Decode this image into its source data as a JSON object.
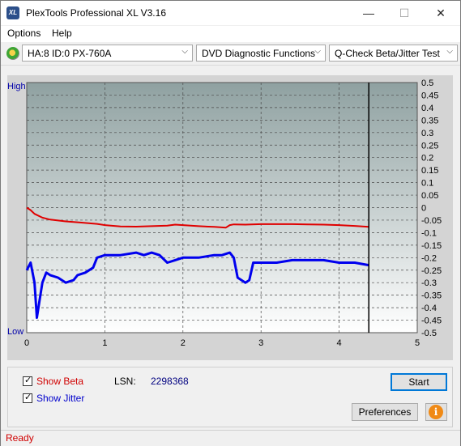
{
  "window": {
    "title": "PlexTools Professional XL V3.16",
    "app_icon_text": "XL",
    "minimize_glyph": "—",
    "maximize_glyph": "☐",
    "close_glyph": "✕"
  },
  "menu": {
    "options": "Options",
    "help": "Help"
  },
  "toolbar": {
    "drive": "HA:8 ID:0  PX-760A",
    "function": "DVD Diagnostic Functions",
    "test": "Q-Check Beta/Jitter Test"
  },
  "chart_data": {
    "type": "line",
    "x_ticks": [
      "0",
      "1",
      "2",
      "3",
      "4",
      "5"
    ],
    "xlim": [
      0,
      5
    ],
    "left_axis_labels": {
      "high": "High",
      "low": "Low"
    },
    "y_ticks": [
      "0.5",
      "0.45",
      "0.4",
      "0.35",
      "0.3",
      "0.25",
      "0.2",
      "0.15",
      "0.1",
      "0.05",
      "0",
      "-0.05",
      "-0.1",
      "-0.15",
      "-0.2",
      "-0.25",
      "-0.3",
      "-0.35",
      "-0.4",
      "-0.45",
      "-0.5"
    ],
    "ylim": [
      -0.5,
      0.5
    ],
    "grid": true,
    "end_marker_x": 4.38,
    "colors": {
      "beta": "#e00000",
      "jitter": "#0000ee",
      "top_bg": "#8fa1a1",
      "bottom_bg": "#ffffff"
    },
    "series": [
      {
        "name": "Beta",
        "color": "#e00000",
        "x": [
          0.0,
          0.05,
          0.1,
          0.2,
          0.3,
          0.5,
          0.7,
          0.9,
          1.0,
          1.2,
          1.4,
          1.6,
          1.8,
          1.9,
          2.0,
          2.2,
          2.4,
          2.55,
          2.6,
          2.65,
          2.8,
          3.0,
          3.2,
          3.4,
          3.6,
          3.8,
          4.0,
          4.2,
          4.38
        ],
        "y": [
          0.0,
          -0.01,
          -0.025,
          -0.04,
          -0.048,
          -0.055,
          -0.06,
          -0.065,
          -0.07,
          -0.075,
          -0.076,
          -0.074,
          -0.072,
          -0.068,
          -0.07,
          -0.074,
          -0.077,
          -0.08,
          -0.07,
          -0.067,
          -0.068,
          -0.066,
          -0.066,
          -0.066,
          -0.067,
          -0.068,
          -0.07,
          -0.073,
          -0.077
        ]
      },
      {
        "name": "Jitter",
        "color": "#0000ee",
        "x": [
          0.0,
          0.05,
          0.1,
          0.13,
          0.16,
          0.2,
          0.25,
          0.3,
          0.4,
          0.5,
          0.6,
          0.65,
          0.75,
          0.85,
          0.9,
          1.0,
          1.2,
          1.4,
          1.5,
          1.6,
          1.7,
          1.8,
          1.9,
          2.0,
          2.2,
          2.4,
          2.5,
          2.6,
          2.65,
          2.7,
          2.8,
          2.85,
          2.9,
          3.0,
          3.2,
          3.4,
          3.6,
          3.8,
          4.0,
          4.2,
          4.38
        ],
        "y": [
          -0.25,
          -0.22,
          -0.3,
          -0.44,
          -0.38,
          -0.3,
          -0.26,
          -0.27,
          -0.28,
          -0.3,
          -0.29,
          -0.27,
          -0.26,
          -0.24,
          -0.2,
          -0.19,
          -0.19,
          -0.18,
          -0.19,
          -0.18,
          -0.19,
          -0.22,
          -0.21,
          -0.2,
          -0.2,
          -0.19,
          -0.19,
          -0.18,
          -0.2,
          -0.28,
          -0.3,
          -0.29,
          -0.22,
          -0.22,
          -0.22,
          -0.21,
          -0.21,
          -0.21,
          -0.22,
          -0.22,
          -0.23
        ]
      }
    ]
  },
  "bottom": {
    "show_beta": "Show Beta",
    "show_jitter": "Show Jitter",
    "lsn_label": "LSN:",
    "lsn_value": "2298368",
    "start": "Start",
    "preferences": "Preferences",
    "info_glyph": "i",
    "check_glyph": "✓",
    "beta_checked": true,
    "jitter_checked": true
  },
  "status": {
    "text": "Ready"
  }
}
